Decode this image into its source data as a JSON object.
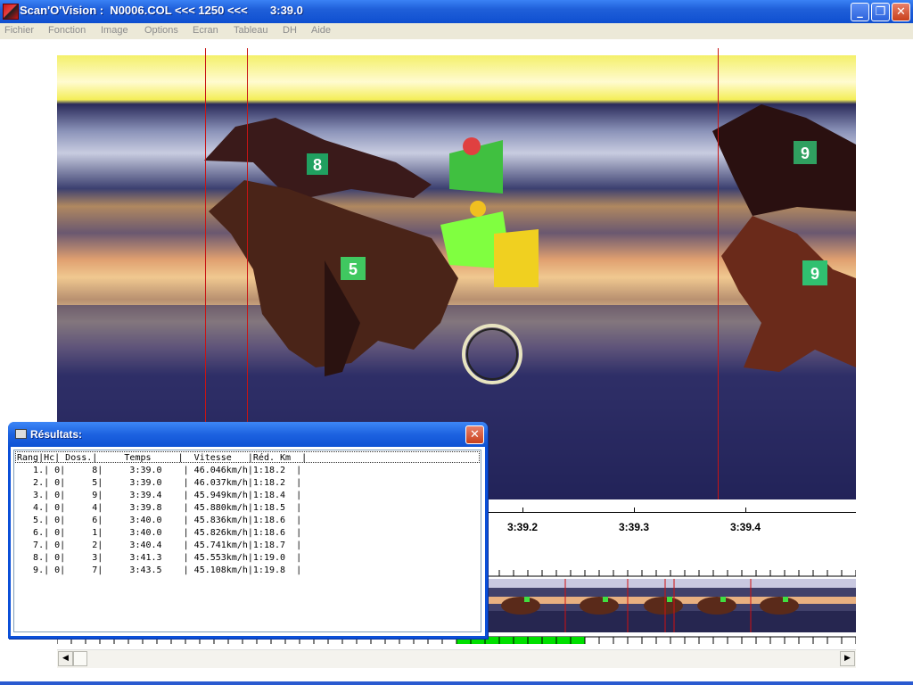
{
  "window": {
    "title": "Scan'O'Vision :  N0006.COL <<< 1250 <<<       3:39.0",
    "minimize_label": "_",
    "maximize_label": "❐",
    "close_label": "✕"
  },
  "menu": [
    "Fichier",
    "Fonction",
    "Image",
    "Options",
    "Ecran",
    "Tableau",
    "DH",
    "Aide"
  ],
  "photo": {
    "saddle_numbers": [
      "8",
      "5",
      "9",
      "9"
    ]
  },
  "ruler": {
    "ticks": [
      "3:39.2",
      "3:39.3",
      "3:39.4"
    ]
  },
  "scrollbar": {
    "left_arrow": "◀",
    "right_arrow": "▶"
  },
  "results": {
    "title": "Résultats:",
    "close_label": "✕",
    "header": "Rang|Hc| Doss.|     Temps     |  Vitesse   |Réd. Km  |",
    "rows": [
      "   1.| 0|     8|     3:39.0    | 46.046km/h|1:18.2  |",
      "   2.| 0|     5|     3:39.0    | 46.037km/h|1:18.2  |",
      "   3.| 0|     9|     3:39.4    | 45.949km/h|1:18.4  |",
      "   4.| 0|     4|     3:39.8    | 45.880km/h|1:18.5  |",
      "   5.| 0|     6|     3:40.0    | 45.836km/h|1:18.6  |",
      "   6.| 0|     1|     3:40.0    | 45.826km/h|1:18.6  |",
      "   7.| 0|     2|     3:40.4    | 45.741km/h|1:18.7  |",
      "   8.| 0|     3|     3:41.3    | 45.553km/h|1:19.0  |",
      "   9.| 0|     7|     3:43.5    | 45.108km/h|1:19.8  |"
    ]
  },
  "colors": {
    "titlebar": "#1f5fd9",
    "cursor_line": "#c81414",
    "menu_text": "#8c8c8c",
    "progress": "#00e000"
  }
}
